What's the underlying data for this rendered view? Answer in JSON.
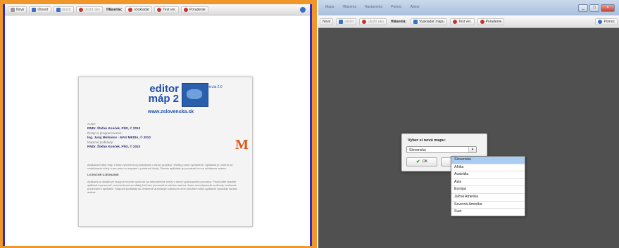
{
  "left_window": {
    "toolbar": {
      "items": [
        {
          "label": "Nový",
          "disabled": false,
          "icon": "new-icon"
        },
        {
          "label": "Otvoriť",
          "disabled": false,
          "icon": "open-icon"
        },
        {
          "label": "Uložiť",
          "disabled": true,
          "icon": "save-icon"
        },
        {
          "label": "Uložiť ako",
          "disabled": true,
          "icon": "save-as-icon"
        }
      ],
      "section_label": "Hlásenia:",
      "actions": [
        {
          "label": "Vyskladať",
          "icon": "pieces-icon"
        },
        {
          "label": "Test ver.",
          "icon": "test-icon"
        },
        {
          "label": "Poradenie",
          "icon": "rank-icon"
        }
      ]
    },
    "about": {
      "logo_line1": "editor",
      "logo_line2": "máp 2",
      "version": "verzia 2.0",
      "website": "www.zslovenska.sk",
      "credits": [
        {
          "label": "Autor:",
          "value": "RNDr. Štefan Konček, PhD, © 2010"
        },
        {
          "label": "Dizajn a programovanie:",
          "value": "Ing. Juraj Molnárov - MAX MEDIA, © 2010"
        },
        {
          "label": "Mapové podklady:",
          "value": "RNDr. Štefan Konček, PhD, © 2010"
        }
      ],
      "m_logo": "M",
      "paragraph1": "Aplikácia Editor máp 2 bola vytvorená a poskytnutá v rámci projektu. Všetky práva vyhradené. Aplikácia je určená na vzdelávacie účely a pre prácu s mapami v prostredí školy. Šírenie aplikácie je povolené len so súhlasom autora.",
      "heading": "LICENČNÉ UJEDNANIE",
      "paragraph2": "Aplikáciu a obsahové mapy je možné využívať na nekomerčné účely v rámci vyučovacieho procesu. Používateľ nesmie aplikáciu upravovať, rozmnožovať ani ďalej šíriť bez písomného súhlasu autora. Autor nezodpovedá za škody vzniknuté používaním aplikácie. Mapové podklady sú chránené autorským zákonom a ich použitie mimo aplikácie vyžaduje súhlas autora."
    }
  },
  "right_window": {
    "menu": [
      "Mapa",
      "Hlásenia",
      "Nastavenia",
      "Pomoc",
      "About"
    ],
    "title_buttons": [
      "_",
      "□",
      "×"
    ],
    "toolbar": {
      "items": [
        {
          "label": "Nový",
          "disabled": false,
          "icon": "new-icon"
        },
        {
          "label": "Uložiť",
          "disabled": true,
          "icon": "save-icon"
        },
        {
          "label": "Uložiť ako",
          "disabled": true,
          "icon": "save-as-icon"
        }
      ],
      "section_label": "Hlásenia:",
      "actions": [
        {
          "label": "Vyskladať mapu",
          "icon": "pieces-icon"
        },
        {
          "label": "Test ver.",
          "icon": "test-icon"
        },
        {
          "label": "Poradenie",
          "icon": "rank-icon"
        }
      ],
      "help_label": "Pomoc"
    },
    "dialog": {
      "title": "Vyber si novú mapu:",
      "selected": "Slovensko",
      "ok_label": "OK"
    },
    "dropdown_options": [
      "Slovensko",
      "Afrika",
      "Austrália",
      "Ázia",
      "Európa",
      "Južná Amerika",
      "Severná Amerika",
      "Svet"
    ]
  }
}
